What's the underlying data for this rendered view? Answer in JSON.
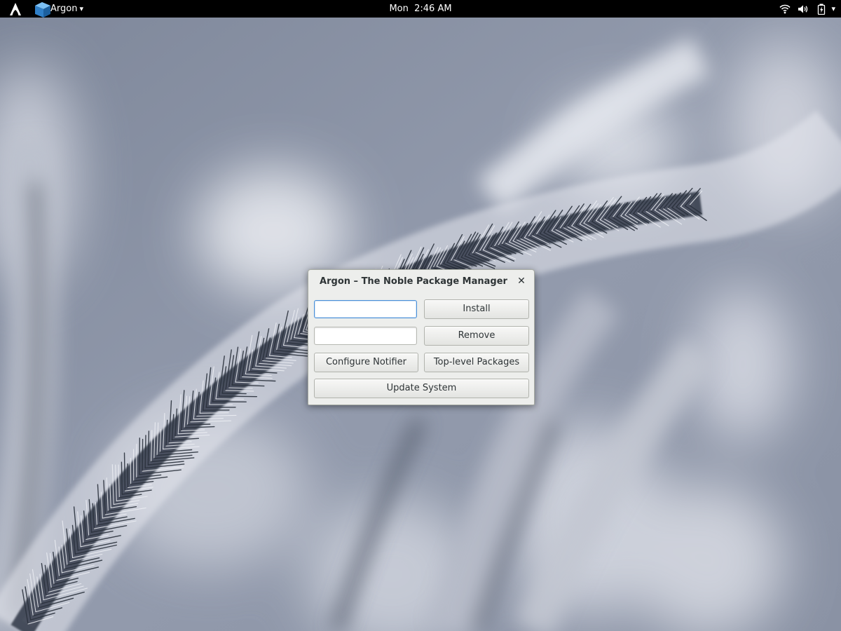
{
  "topbar": {
    "app_name": "Argon",
    "app_caret": "▾",
    "clock_day": "Mon",
    "clock_time": "2:46 AM",
    "status_caret": "▾"
  },
  "dialog": {
    "title": "Argon – The Noble Package Manager",
    "close_glyph": "✕",
    "install_input_value": "",
    "remove_input_value": "",
    "install_label": "Install",
    "remove_label": "Remove",
    "configure_notifier_label": "Configure Notifier",
    "top_level_packages_label": "Top-level Packages",
    "update_system_label": "Update System"
  },
  "icons": {
    "activities": "arch-logo-icon",
    "app": "package-box-icon",
    "wifi": "wifi-icon",
    "volume": "volume-icon",
    "battery": "battery-icon"
  },
  "colors": {
    "topbar_bg": "#000000",
    "dialog_bg": "#edeeec",
    "focus": "#4a90d9",
    "app_icon_blue": "#3a8fd8"
  }
}
